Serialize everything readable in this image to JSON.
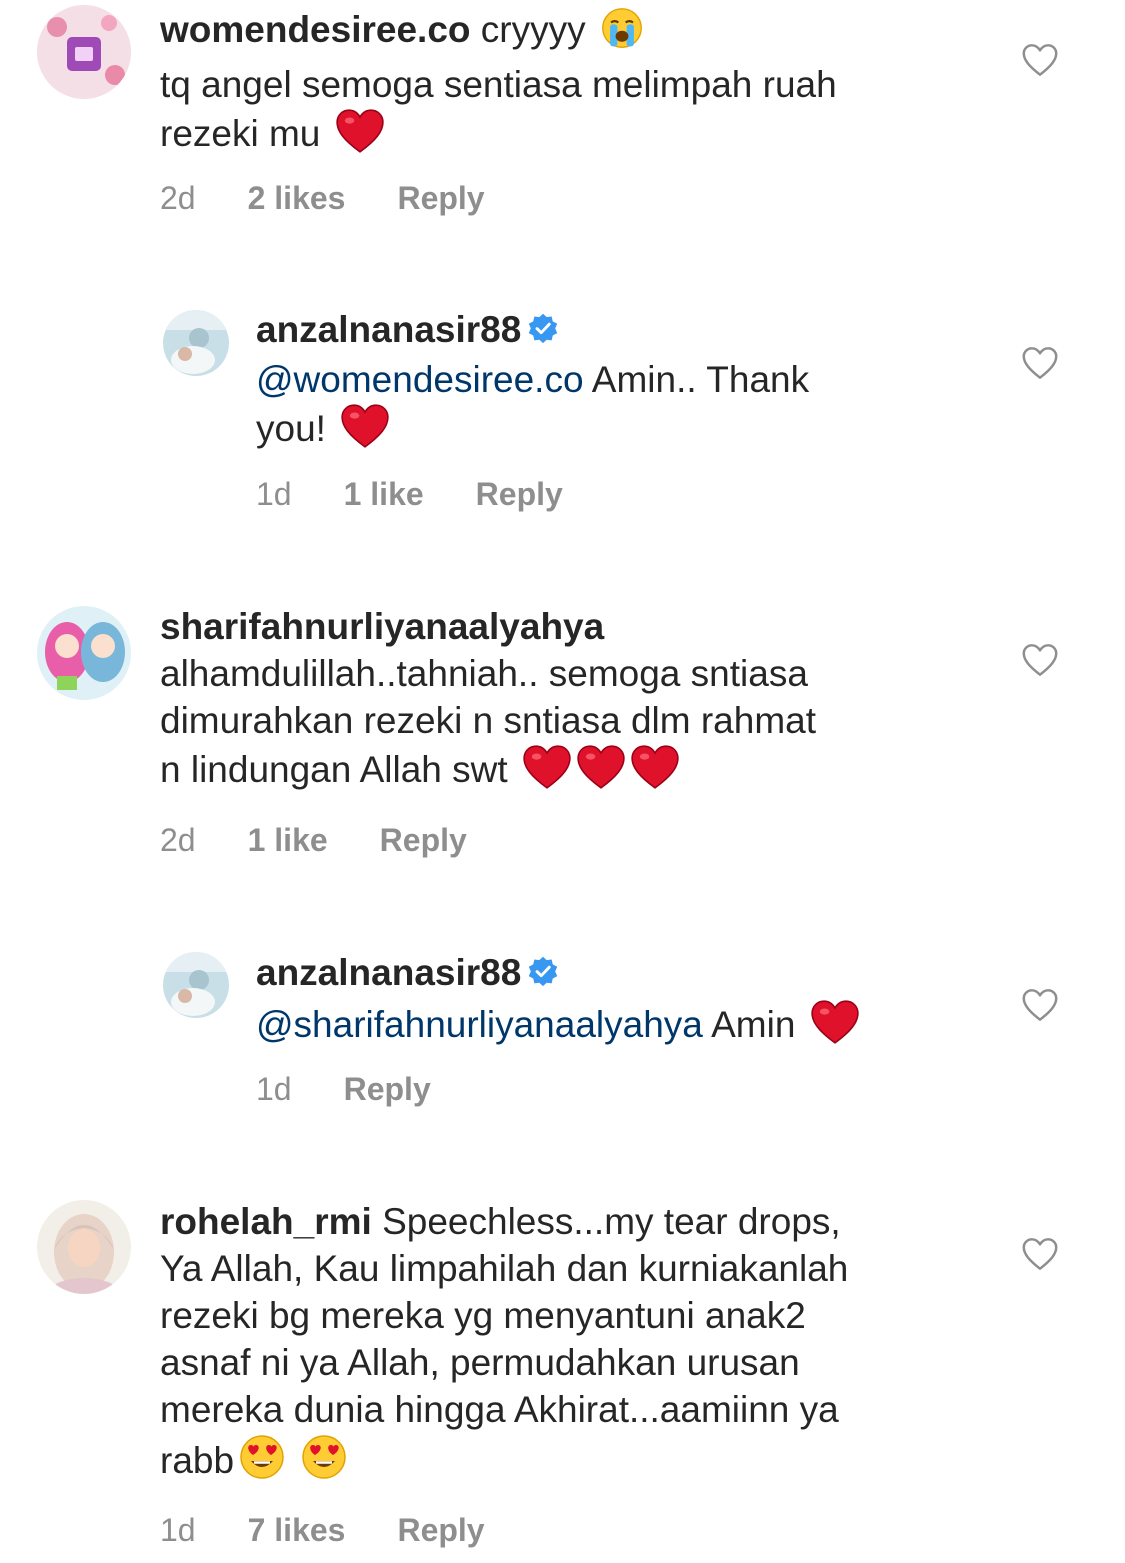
{
  "comments": [
    {
      "username": "womendesiree.co",
      "text": "cryyyy",
      "line2": "tq angel semoga sentiasa melimpah ruah",
      "line3": "rezeki mu",
      "time": "2d",
      "likes": "2 likes",
      "reply": "Reply",
      "emojis": [
        "loudly-crying-face",
        "red-heart"
      ]
    },
    {
      "username": "anzalnanasir88",
      "verified": true,
      "mention": "@womendesiree.co",
      "text": "Amin.. Thank",
      "line2": "you!",
      "time": "1d",
      "likes": "1 like",
      "reply": "Reply",
      "emojis": [
        "red-heart"
      ]
    },
    {
      "username": "sharifahnurliyanaalyahya",
      "line1": "alhamdulillah..tahniah.. semoga sntiasa",
      "line2": "dimurahkan rezeki n sntiasa dlm rahmat",
      "line3": "n lindungan Allah swt",
      "time": "2d",
      "likes": "1 like",
      "reply": "Reply",
      "emojis": [
        "red-heart",
        "red-heart",
        "red-heart"
      ]
    },
    {
      "username": "anzalnanasir88",
      "verified": true,
      "mention": "@sharifahnurliyanaalyahya",
      "text": "Amin",
      "time": "1d",
      "reply": "Reply",
      "emojis": [
        "red-heart"
      ]
    },
    {
      "username": "rohelah_rmi",
      "text": "Speechless...my tear drops,",
      "line2": "Ya Allah, Kau limpahilah dan kurniakanlah",
      "line3": "rezeki bg mereka yg menyantuni anak2",
      "line4": "asnaf ni ya Allah, permudahkan urusan",
      "line5": "mereka dunia hingga Akhirat...aamiinn ya",
      "line6": "rabb",
      "time": "1d",
      "likes": "7 likes",
      "reply": "Reply",
      "emojis": [
        "heart-eyes-face",
        "heart-eyes-face"
      ]
    }
  ],
  "colors": {
    "text": "#262626",
    "meta": "#8e8e8e",
    "mention": "#00376b",
    "verified": "#3897f0",
    "heart": "#e0112b"
  }
}
